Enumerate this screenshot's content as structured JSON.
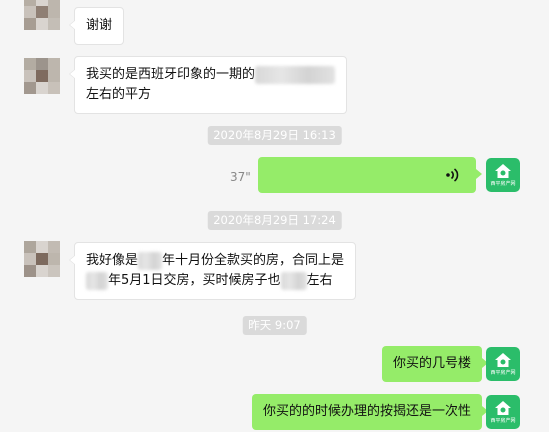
{
  "messages": {
    "m1": {
      "text": "谢谢"
    },
    "m2": {
      "line1": "我买的是西班牙印象的一期的",
      "line2": "左右的平方"
    },
    "t1": "2020年8月29日 16:13",
    "voice": {
      "duration": "37\"",
      "icon": "voice-wave-icon"
    },
    "t2": "2020年8月29日 17:24",
    "m3": {
      "l1a": "我好像是",
      "l1b": "年十月份全款买的房，合同上是",
      "l2a": "年5月1日交房，买时候房子也",
      "l2b": "左右"
    },
    "t3": "昨天 9:07",
    "m4": {
      "text": "你买的几号楼"
    },
    "m5": {
      "text": "你买的的时候办理的按揭还是一次性"
    }
  },
  "avatar_right": {
    "logo_text": "西平房产网"
  },
  "colors": {
    "background": "#f5f5f5",
    "outgoing": "#95ec69",
    "incoming": "#ffffff",
    "brand": "#2bbd6a"
  }
}
